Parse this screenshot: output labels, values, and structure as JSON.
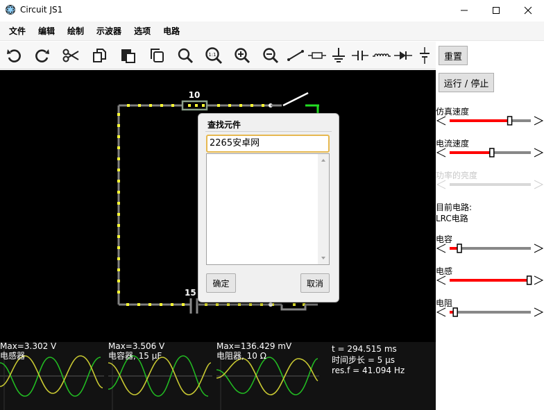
{
  "window": {
    "title": "Circuit JS1"
  },
  "menu": [
    "文件",
    "编辑",
    "绘制",
    "示波器",
    "选项",
    "电路"
  ],
  "toolbar_icons": [
    "undo-icon",
    "redo-icon",
    "cut-icon",
    "copy-icon",
    "paste-icon",
    "duplicate-icon",
    "zoom-icon",
    "zoom-100-icon",
    "zoom-in-icon",
    "zoom-out-icon",
    "wire-icon",
    "resistor-icon",
    "ground-icon",
    "capacitor-icon",
    "inductor-icon",
    "diode-icon",
    "voltage-source-icon"
  ],
  "toolbar": {
    "zoom100_label": "1:1"
  },
  "sidebar": {
    "reset_label": "重置",
    "run_stop_label": "运行 / 停止",
    "sim_speed_label": "仿真速度",
    "sim_speed_value": 0.74,
    "current_speed_label": "电流速度",
    "current_speed_value": 0.52,
    "power_brightness_label": "功率的亮度",
    "current_circuit_label": "目前电路:",
    "current_circuit_name": "LRC电路",
    "capacitance_label": "电容",
    "capacitance_value": 0.12,
    "inductance_label": "电感",
    "inductance_value": 0.98,
    "resistance_label": "电阻",
    "resistance_value": 0.07,
    "colors": {
      "slider_fill": "#ff0000",
      "slider_track": "#888888"
    }
  },
  "circuit": {
    "resistor_label": "10",
    "capacitor_label": "15"
  },
  "dialog": {
    "title": "查找元件",
    "search_value": "2265安卓网",
    "ok_label": "确定",
    "cancel_label": "取消"
  },
  "scopes": [
    {
      "max": "Max=3.302 V",
      "name": "电感器"
    },
    {
      "max": "Max=3.506 V",
      "name": "电容器, 15 μF"
    },
    {
      "max": "Max=136.429 mV",
      "name": "电阻器, 10 Ω"
    }
  ],
  "sim_info": {
    "time": "t = 294.515 ms",
    "timestep": "时间步长 = 5 μs",
    "resf": "res.f = 41.094 Hz"
  }
}
